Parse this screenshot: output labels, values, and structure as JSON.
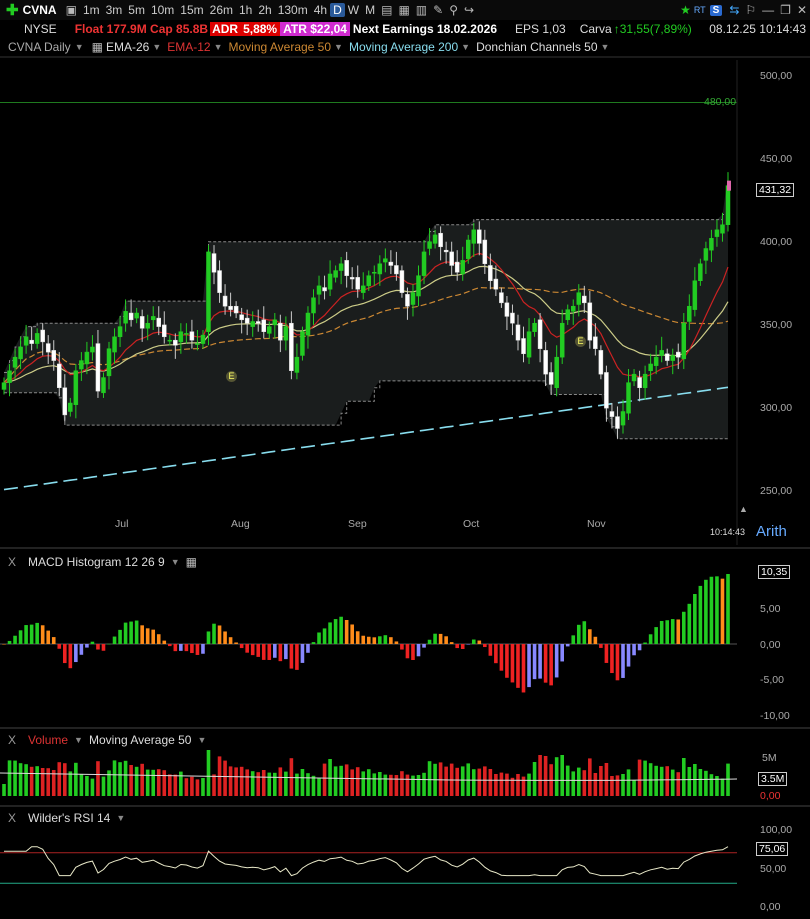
{
  "toolbar": {
    "symbol": "CVNA",
    "timeframes": [
      "1m",
      "3m",
      "5m",
      "10m",
      "15m",
      "26m",
      "1h",
      "2h",
      "130m",
      "4h",
      "D",
      "W",
      "M"
    ],
    "active_timeframe": "D",
    "datetime": "08.12.25 10:14:43",
    "rt_label": "RT",
    "s_label": "S"
  },
  "info": {
    "exchange": "NYSE",
    "float_cap": "Float 177.9M Cap 85.8B",
    "adr_label": "ADR",
    "adr_value": "5,88%",
    "atr": "ATR $22,04",
    "earnings": "Next Earnings 18.02.2026",
    "eps": "EPS 1,03",
    "company": "Carva",
    "change": "31,55(7,89%)"
  },
  "studies": {
    "chart_name": "CVNA Daily",
    "ema26": "EMA-26",
    "ema12": "EMA-12",
    "ma50": "Moving Average 50",
    "ma200": "Moving Average 200",
    "donchian": "Donchian Channels 50"
  },
  "price_scale": {
    "labels": [
      "500,00",
      "450,00",
      "400,00",
      "350,00",
      "300,00",
      "250,00"
    ],
    "hline_label": "480,00",
    "last_price": "431,32",
    "mode": "Arith",
    "cursor_time": "10:14:43"
  },
  "months": [
    "Jul",
    "Aug",
    "Sep",
    "Oct",
    "Nov"
  ],
  "earnings_marker": "E",
  "macd": {
    "title": "MACD Histogram 12 26 9",
    "labels": [
      "5,00",
      "0,00",
      "-5,00",
      "-10,00"
    ],
    "last": "10,35",
    "close": "X"
  },
  "volume": {
    "title_a": "Volume",
    "title_b": "Moving Average 50",
    "labels": [
      "5M",
      "0,00"
    ],
    "last": "3.5M",
    "close": "X"
  },
  "rsi": {
    "title": "Wilder's RSI 14",
    "labels": [
      "100,00",
      "50,00",
      "0,00"
    ],
    "last": "75,06",
    "close": "X"
  },
  "colors": {
    "up": "#22cc22",
    "down": "#dd2222",
    "macd_up": "#22cc22",
    "macd_up_fading": "#ff8c1a",
    "macd_down": "#ee2222",
    "macd_down_rising": "#8888ff",
    "ema26": "#b33",
    "ma50": "#cc8833",
    "ma200": "#88ddee",
    "donchian": "#888"
  },
  "chart_data": {
    "type": "candlestick",
    "y_range": [
      240,
      505
    ],
    "closes": [
      315,
      322,
      330,
      336,
      342,
      338,
      344,
      339,
      333,
      328,
      312,
      296,
      303,
      322,
      328,
      333,
      336,
      310,
      318,
      335,
      342,
      348,
      357,
      352,
      356,
      347,
      350,
      354,
      348,
      342,
      340,
      337,
      345,
      344,
      340,
      338,
      343,
      392,
      380,
      368,
      360,
      358,
      356,
      352,
      350,
      351,
      350,
      345,
      348,
      352,
      340,
      348,
      322,
      330,
      345,
      356,
      365,
      372,
      369,
      379,
      381,
      385,
      378,
      376,
      370,
      372,
      378,
      380,
      385,
      388,
      384,
      379,
      368,
      360,
      368,
      378,
      392,
      398,
      402,
      395,
      392,
      384,
      380,
      387,
      399,
      405,
      397,
      385,
      375,
      370,
      362,
      354,
      350,
      340,
      332,
      345,
      350,
      335,
      320,
      314,
      330,
      350,
      358,
      360,
      368,
      362,
      340,
      335,
      320,
      300,
      295,
      288,
      298,
      315,
      320,
      312,
      320,
      326,
      330,
      334,
      328,
      331,
      330,
      350,
      360,
      375,
      385,
      394,
      400,
      405,
      408,
      431
    ]
  }
}
